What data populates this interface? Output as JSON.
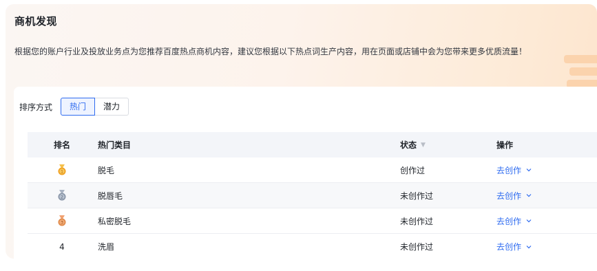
{
  "page": {
    "title": "商机发现",
    "description": "根据您的账户行业及投放业务点为您推荐百度热点商机内容，建议您根据以下热点词生产内容，用在页面或店铺中会为您带来更多优质流量！"
  },
  "sort": {
    "label": "排序方式",
    "options": [
      "热门",
      "潜力"
    ],
    "active": "热门"
  },
  "table": {
    "headers": {
      "rank": "排名",
      "category": "热门类目",
      "status": "状态",
      "action": "操作"
    },
    "rows": [
      {
        "rank": "1",
        "medal": "gold-medal-icon",
        "category": "脱毛",
        "status": "创作过",
        "action": "去创作"
      },
      {
        "rank": "2",
        "medal": "silver-medal-icon",
        "category": "脱唇毛",
        "status": "未创作过",
        "action": "去创作"
      },
      {
        "rank": "3",
        "medal": "bronze-medal-icon",
        "category": "私密脱毛",
        "status": "未创作过",
        "action": "去创作"
      },
      {
        "rank": "4",
        "medal": "",
        "category": "洗眉",
        "status": "未创作过",
        "action": "去创作"
      }
    ]
  },
  "colors": {
    "accent": "#2e6bf0",
    "gold": "#f0a020",
    "silver": "#8a96a8",
    "bronze": "#e08a4a"
  }
}
